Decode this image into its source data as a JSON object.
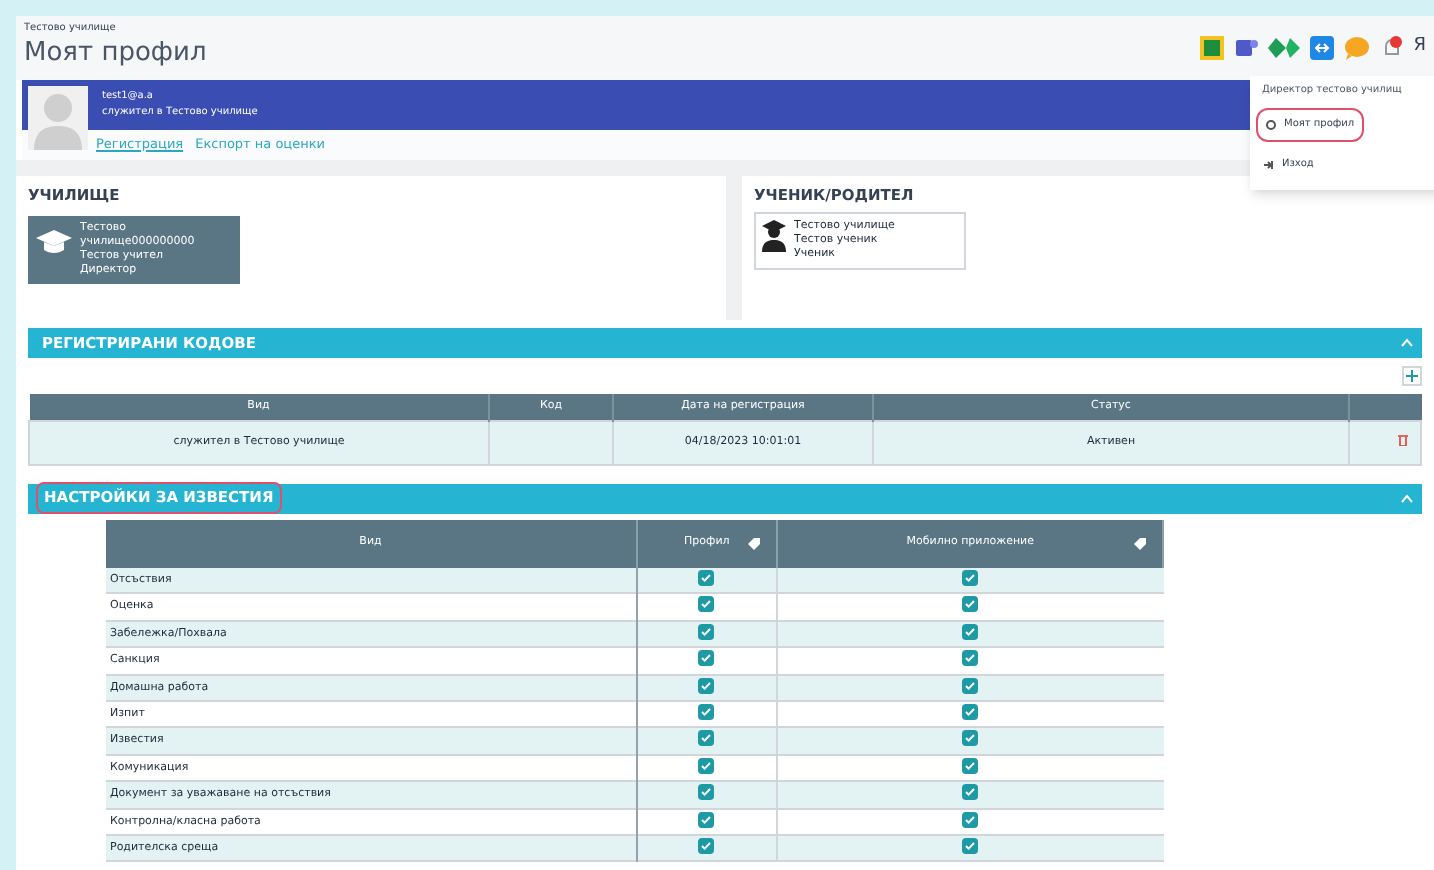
{
  "header": {
    "breadcrumb": "Тестово училище",
    "title": "Моят профил",
    "user_initial": "Я"
  },
  "profile": {
    "email": "test1@a.a",
    "role": "служител в Тестово училище",
    "links": [
      "Регистрация",
      "Експорт на оценки"
    ]
  },
  "user_menu": {
    "heading": "Директор тестово училищ",
    "items": [
      {
        "label": "Моят профил",
        "highlighted": true
      },
      {
        "label": "Изход",
        "highlighted": false
      }
    ]
  },
  "school": {
    "title": "УЧИЛИЩЕ",
    "lines": [
      "Тестово",
      "училище000000000",
      "Тестов учител",
      "Директор"
    ]
  },
  "student": {
    "title": "УЧЕНИК/РОДИТЕЛ",
    "lines": [
      "Тестово училище",
      "Тестов ученик",
      "Ученик"
    ]
  },
  "codes": {
    "title": "РЕГИСТРИРАНИ КОДОВЕ",
    "highlighted": false,
    "columns": [
      "Вид",
      "Код",
      "Дата на регистрация",
      "Статус"
    ],
    "rows": [
      {
        "cells": [
          "служител в Тестово училище",
          "",
          "04/18/2023 10:01:01",
          "Активен"
        ]
      }
    ]
  },
  "notifications": {
    "title": "НАСТРОЙКИ ЗА ИЗВЕСТИЯ",
    "highlighted": true,
    "columns": [
      "Вид",
      "Профил",
      "Мобилно приложение"
    ],
    "rows": [
      {
        "label": "Отсъствия",
        "profile": true,
        "mobile": true
      },
      {
        "label": "Оценка",
        "profile": true,
        "mobile": true
      },
      {
        "label": "Забележка/Похвала",
        "profile": true,
        "mobile": true
      },
      {
        "label": "Санкция",
        "profile": true,
        "mobile": true
      },
      {
        "label": "Домашна работа",
        "profile": true,
        "mobile": true
      },
      {
        "label": "Изпит",
        "profile": true,
        "mobile": true
      },
      {
        "label": "Известия",
        "profile": true,
        "mobile": true
      },
      {
        "label": "Комуникация",
        "profile": true,
        "mobile": true
      },
      {
        "label": "Документ за уважаване на отсъствия",
        "profile": true,
        "mobile": true
      },
      {
        "label": "Контролна/класна работа",
        "profile": true,
        "mobile": true
      },
      {
        "label": "Родителска среща",
        "profile": true,
        "mobile": true
      }
    ]
  }
}
